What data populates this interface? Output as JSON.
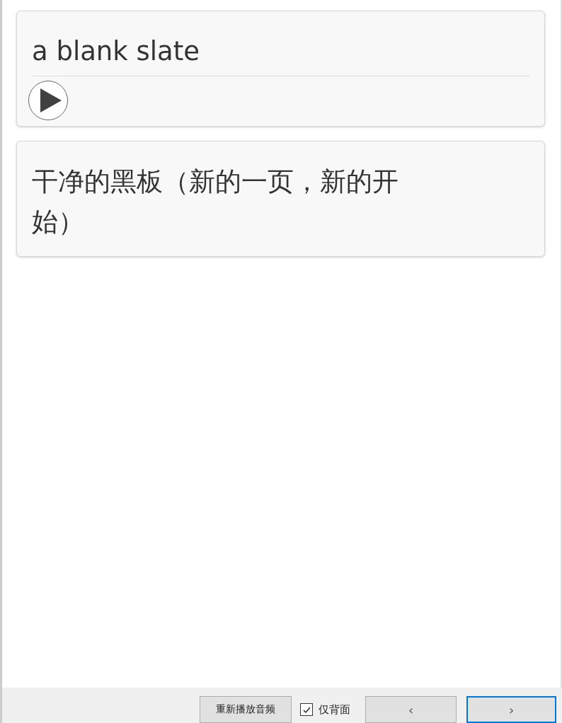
{
  "cards": [
    {
      "text": "a blank slate",
      "has_audio": true
    },
    {
      "text": "干净的黑板（新的一页，新的开始）",
      "has_audio": false
    }
  ],
  "bottom_bar": {
    "replay_button": "重新播放音频",
    "back_only": {
      "label": "仅背面",
      "checked": true
    },
    "prev_button": "‹",
    "next_button": "›"
  }
}
